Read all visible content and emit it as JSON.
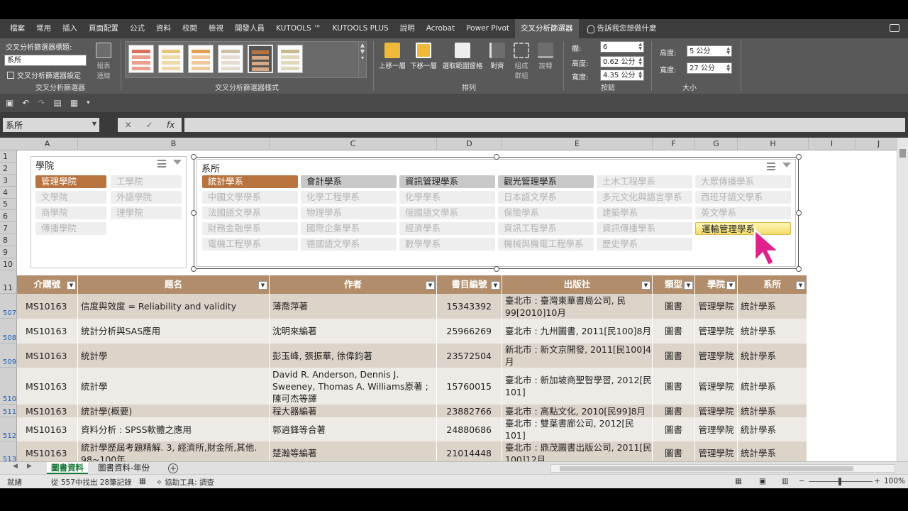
{
  "ribbon_tabs": [
    "檔案",
    "常用",
    "插入",
    "頁面配置",
    "公式",
    "資料",
    "校閱",
    "檢視",
    "開發人員",
    "KUTOOLS ™",
    "KUTOOLS PLUS",
    "說明",
    "Acrobat",
    "Power Pivot",
    "交叉分析篩選器"
  ],
  "tell_me": "告訴我您想做什麼",
  "ribbon": {
    "caption_label": "交叉分析篩選器標題:",
    "caption_value": "系所",
    "settings_label": "交叉分析篩選器設定",
    "group1_label": "交叉分析篩選器",
    "report_conn": "報表連線",
    "styles_label": "交叉分析篩選器樣式",
    "bring_forward": "上移一層",
    "send_backward": "下移一層",
    "selection_pane": "選取範圍窗格",
    "align": "對齊",
    "group": "組成群組",
    "rotate": "旋轉",
    "arrange_label": "排列",
    "columns_label": "欄:",
    "columns_value": "6",
    "btn_height_label": "高度:",
    "btn_height_value": "0.62 公分",
    "btn_width_label": "寬度:",
    "btn_width_value": "4.35 公分",
    "buttons_label": "按鈕",
    "height_label": "高度:",
    "height_value": "5 公分",
    "width_label": "寬度:",
    "width_value": "27 公分",
    "size_label": "大小"
  },
  "formula_bar": {
    "name_box": "系所",
    "fx": "fx"
  },
  "columns": [
    "A",
    "B",
    "C",
    "D",
    "E",
    "F",
    "G",
    "H",
    "I",
    "J"
  ],
  "row_numbers_top": [
    "1",
    "2",
    "3",
    "4",
    "5",
    "6",
    "7",
    "8",
    "9",
    "10",
    "11"
  ],
  "row_numbers_data": [
    "507",
    "508",
    "509",
    "510",
    "511",
    "512",
    "513"
  ],
  "slicer_college": {
    "title": "學院",
    "items": [
      {
        "label": "管理學院",
        "state": "sel"
      },
      {
        "label": "工學院",
        "state": "nodata"
      },
      {
        "label": "文學院",
        "state": "nodata"
      },
      {
        "label": "外語學院",
        "state": "nodata"
      },
      {
        "label": "商學院",
        "state": "nodata"
      },
      {
        "label": "理學院",
        "state": "nodata"
      },
      {
        "label": "傳播學院",
        "state": "nodata"
      }
    ]
  },
  "slicer_dept": {
    "title": "系所",
    "items": [
      {
        "label": "統計學系",
        "state": "sel"
      },
      {
        "label": "會計學系",
        "state": "sel2"
      },
      {
        "label": "資訊管理學系",
        "state": "sel2"
      },
      {
        "label": "觀光管理學系",
        "state": "sel2"
      },
      {
        "label": "土木工程學系",
        "state": "nodata"
      },
      {
        "label": "大眾傳播學系",
        "state": "nodata"
      },
      {
        "label": "中國文學學系",
        "state": "nodata"
      },
      {
        "label": "化學工程學系",
        "state": "nodata"
      },
      {
        "label": "化學學系",
        "state": "nodata"
      },
      {
        "label": "日本語文學系",
        "state": "nodata"
      },
      {
        "label": "多元文化與語言學系",
        "state": "nodata"
      },
      {
        "label": "西班牙語文學系",
        "state": "nodata"
      },
      {
        "label": "法國語文學系",
        "state": "nodata"
      },
      {
        "label": "物理學系",
        "state": "nodata"
      },
      {
        "label": "俄國語文學系",
        "state": "nodata"
      },
      {
        "label": "保險學系",
        "state": "nodata"
      },
      {
        "label": "建築學系",
        "state": "nodata"
      },
      {
        "label": "英文學系",
        "state": "nodata"
      },
      {
        "label": "財務金融學系",
        "state": "nodata"
      },
      {
        "label": "國際企業學系",
        "state": "nodata"
      },
      {
        "label": "經濟學系",
        "state": "nodata"
      },
      {
        "label": "資訊工程學系",
        "state": "nodata"
      },
      {
        "label": "資訊傳播學系",
        "state": "nodata"
      },
      {
        "label": "運輸管理學系",
        "state": "hover"
      },
      {
        "label": "電機工程學系",
        "state": "nodata"
      },
      {
        "label": "德國語文學系",
        "state": "nodata"
      },
      {
        "label": "數學學系",
        "state": "nodata"
      },
      {
        "label": "機械與機電工程學系",
        "state": "nodata"
      },
      {
        "label": "歷史學系",
        "state": "nodata"
      }
    ]
  },
  "table": {
    "headers": [
      "介購號",
      "題名",
      "作者",
      "書目編號",
      "出版社",
      "類型",
      "學院",
      "系所"
    ],
    "rows": [
      {
        "rowno": "507",
        "cells": [
          "MS10163",
          "信度與效度 = Reliability and validity",
          "薄喬萍著",
          "15343392",
          "臺北市 : 臺灣東華書局公司, 民99[2010]10月",
          "圖書",
          "管理學院",
          "統計學系"
        ]
      },
      {
        "rowno": "508",
        "cells": [
          "MS10163",
          "統計分析與SAS應用",
          "沈明來編著",
          "25966269",
          "臺北市 : 九州圖書, 2011[民100]8月",
          "圖書",
          "管理學院",
          "統計學系"
        ]
      },
      {
        "rowno": "509",
        "cells": [
          "MS10163",
          "統計學",
          "彭玉峰, 張振華, 徐偉鈞著",
          "23572504",
          "新北市 : 新文京開發, 2011[民100]4月",
          "圖書",
          "管理學院",
          "統計學系"
        ]
      },
      {
        "rowno": "510",
        "cells": [
          "MS10163",
          "統計學",
          "David R. Anderson, Dennis J. Sweeney, Thomas A. Williams原著 ; 陳可杰等譯",
          "15760015",
          "臺北市 : 新加坡商聖智學習, 2012[民101]",
          "圖書",
          "管理學院",
          "統計學系"
        ]
      },
      {
        "rowno": "511",
        "cells": [
          "MS10163",
          "統計學(概要)",
          "程大器編著",
          "23882766",
          "臺北市 : 高點文化, 2010[民99]8月",
          "圖書",
          "管理學院",
          "統計學系"
        ]
      },
      {
        "rowno": "512",
        "cells": [
          "MS10163",
          "資料分析 : SPSS軟體之應用",
          "郭逍鋒等合著",
          "24880686",
          "臺北市 : 雙葉書廊公司, 2012[民101]",
          "圖書",
          "管理學院",
          "統計學系"
        ]
      },
      {
        "rowno": "513",
        "cells": [
          "MS10163",
          "統計學歷屆考題精解. 3, 經濟所,財金所,其他. 98~100年",
          "楚瀚等編著",
          "21014448",
          "臺北市 : 鼎茂圖書出版公司, 2011[民100]12月",
          "圖書",
          "管理學院",
          "統計學系"
        ]
      }
    ]
  },
  "sheet_tabs": [
    "圖書資料",
    "圖書資料-年份"
  ],
  "status": {
    "ready": "就緒",
    "found": "從 557中找出 28筆記錄",
    "accessibility": "協助工具: 調查",
    "zoom": "100%"
  },
  "colors": {
    "selected": "#b8733f",
    "header": "#b28d6b",
    "row_dark": "#ddd4c9",
    "row_light": "#eeeae5"
  }
}
